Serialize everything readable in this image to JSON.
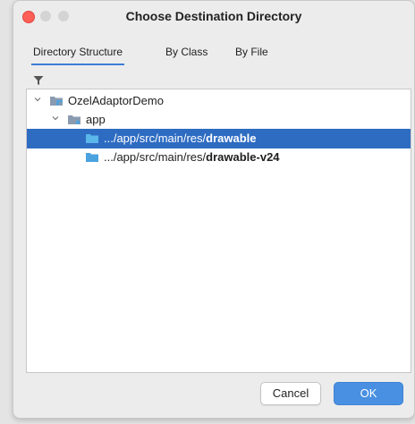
{
  "window": {
    "title": "Choose Destination Directory"
  },
  "tabs": [
    {
      "label": "Directory Structure",
      "active": true
    },
    {
      "label": "By Class",
      "active": false
    },
    {
      "label": "By File",
      "active": false
    }
  ],
  "tree": [
    {
      "label": "OzelAdaptorDemo",
      "prefix": "",
      "bold": "",
      "expanded": true,
      "selected": false,
      "icon": "project-folder-icon"
    },
    {
      "label": "app",
      "prefix": "",
      "bold": "",
      "expanded": true,
      "selected": false,
      "icon": "module-folder-icon"
    },
    {
      "label": "",
      "prefix": ".../app/src/main/res/",
      "bold": "drawable",
      "expanded": false,
      "selected": true,
      "icon": "folder-icon"
    },
    {
      "label": "",
      "prefix": ".../app/src/main/res/",
      "bold": "drawable-v24",
      "expanded": false,
      "selected": false,
      "icon": "folder-icon"
    }
  ],
  "buttons": {
    "cancel": "Cancel",
    "ok": "OK"
  },
  "colors": {
    "selection": "#2e6cc2",
    "primary_button": "#4a90e2",
    "folder": "#4aa3df"
  }
}
